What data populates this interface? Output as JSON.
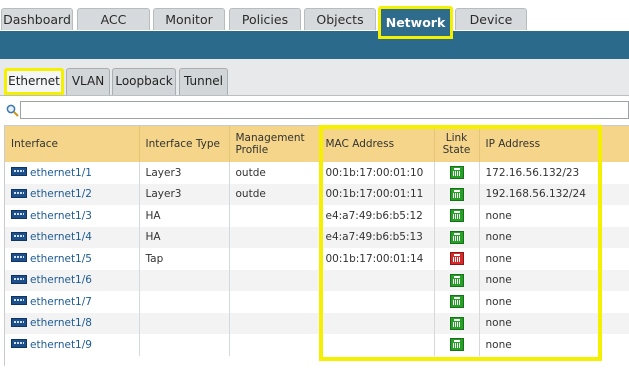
{
  "nav": {
    "tabs": [
      "Dashboard",
      "ACC",
      "Monitor",
      "Policies",
      "Objects",
      "Network",
      "Device"
    ],
    "active": "Network"
  },
  "subnav": {
    "tabs": [
      "Ethernet",
      "VLAN",
      "Loopback",
      "Tunnel"
    ],
    "active": "Ethernet"
  },
  "filter": {
    "value": "",
    "icon": "search-icon"
  },
  "table": {
    "columns": {
      "interface": "Interface",
      "type": "Interface Type",
      "mgmt_line1": "Management",
      "mgmt_line2": "Profile",
      "mac": "MAC Address",
      "link_line1": "Link",
      "link_line2": "State",
      "ip": "IP Address"
    },
    "rows": [
      {
        "interface": "ethernet1/1",
        "type": "Layer3",
        "mgmt": "outde",
        "mac": "00:1b:17:00:01:10",
        "link": "up",
        "ip": "172.16.56.132/23"
      },
      {
        "interface": "ethernet1/2",
        "type": "Layer3",
        "mgmt": "outde",
        "mac": "00:1b:17:00:01:11",
        "link": "up",
        "ip": "192.168.56.132/24"
      },
      {
        "interface": "ethernet1/3",
        "type": "HA",
        "mgmt": "",
        "mac": "e4:a7:49:b6:b5:12",
        "link": "up",
        "ip": "none"
      },
      {
        "interface": "ethernet1/4",
        "type": "HA",
        "mgmt": "",
        "mac": "e4:a7:49:b6:b5:13",
        "link": "up",
        "ip": "none"
      },
      {
        "interface": "ethernet1/5",
        "type": "Tap",
        "mgmt": "",
        "mac": "00:1b:17:00:01:14",
        "link": "down",
        "ip": "none"
      },
      {
        "interface": "ethernet1/6",
        "type": "",
        "mgmt": "",
        "mac": "",
        "link": "up",
        "ip": "none"
      },
      {
        "interface": "ethernet1/7",
        "type": "",
        "mgmt": "",
        "mac": "",
        "link": "up",
        "ip": "none"
      },
      {
        "interface": "ethernet1/8",
        "type": "",
        "mgmt": "",
        "mac": "",
        "link": "up",
        "ip": "none"
      },
      {
        "interface": "ethernet1/9",
        "type": "",
        "mgmt": "",
        "mac": "",
        "link": "up",
        "ip": "none"
      }
    ]
  },
  "colors": {
    "highlight": "#f5f000",
    "header_band": "#2c6a8b",
    "table_header": "#f4d58a",
    "link_up": "#25a125",
    "link_down": "#d42a2a"
  }
}
